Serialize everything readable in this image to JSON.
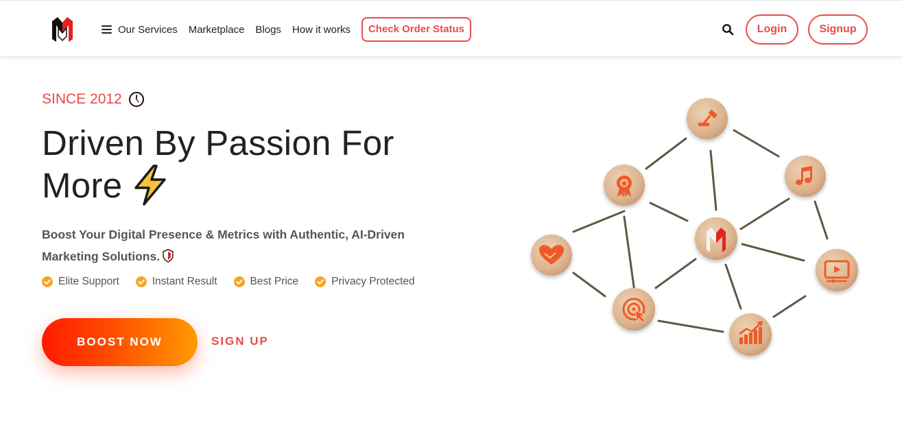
{
  "header": {
    "nav": {
      "services": "Our Services",
      "marketplace": "Marketplace",
      "blogs": "Blogs",
      "how_it_works": "How it works",
      "check_order_status": "Check Order Status"
    },
    "login": "Login",
    "signup": "Signup"
  },
  "hero": {
    "since": "SINCE 2012",
    "title": "Driven By Passion For More",
    "subtitle": "Boost Your Digital Presence & Metrics with Authentic, AI-Driven Marketing Solutions.",
    "features": [
      "Elite Support",
      "Instant Result",
      "Best Price",
      "Privacy Protected"
    ],
    "boost_button": "BOOST NOW",
    "signup_link": "SIGN UP"
  },
  "colors": {
    "accent": "#e84b4b",
    "check": "#f5a623",
    "gradient_start": "#ff1a00",
    "gradient_end": "#ff9a00",
    "icon_orange": "#ef5a2a",
    "wood": "#ddb48f"
  },
  "network_icons": [
    "hammer-icon",
    "music-note-icon",
    "award-badge-icon",
    "brand-logo-icon",
    "heart-hands-icon",
    "video-play-icon",
    "target-click-icon",
    "growth-chart-icon"
  ]
}
